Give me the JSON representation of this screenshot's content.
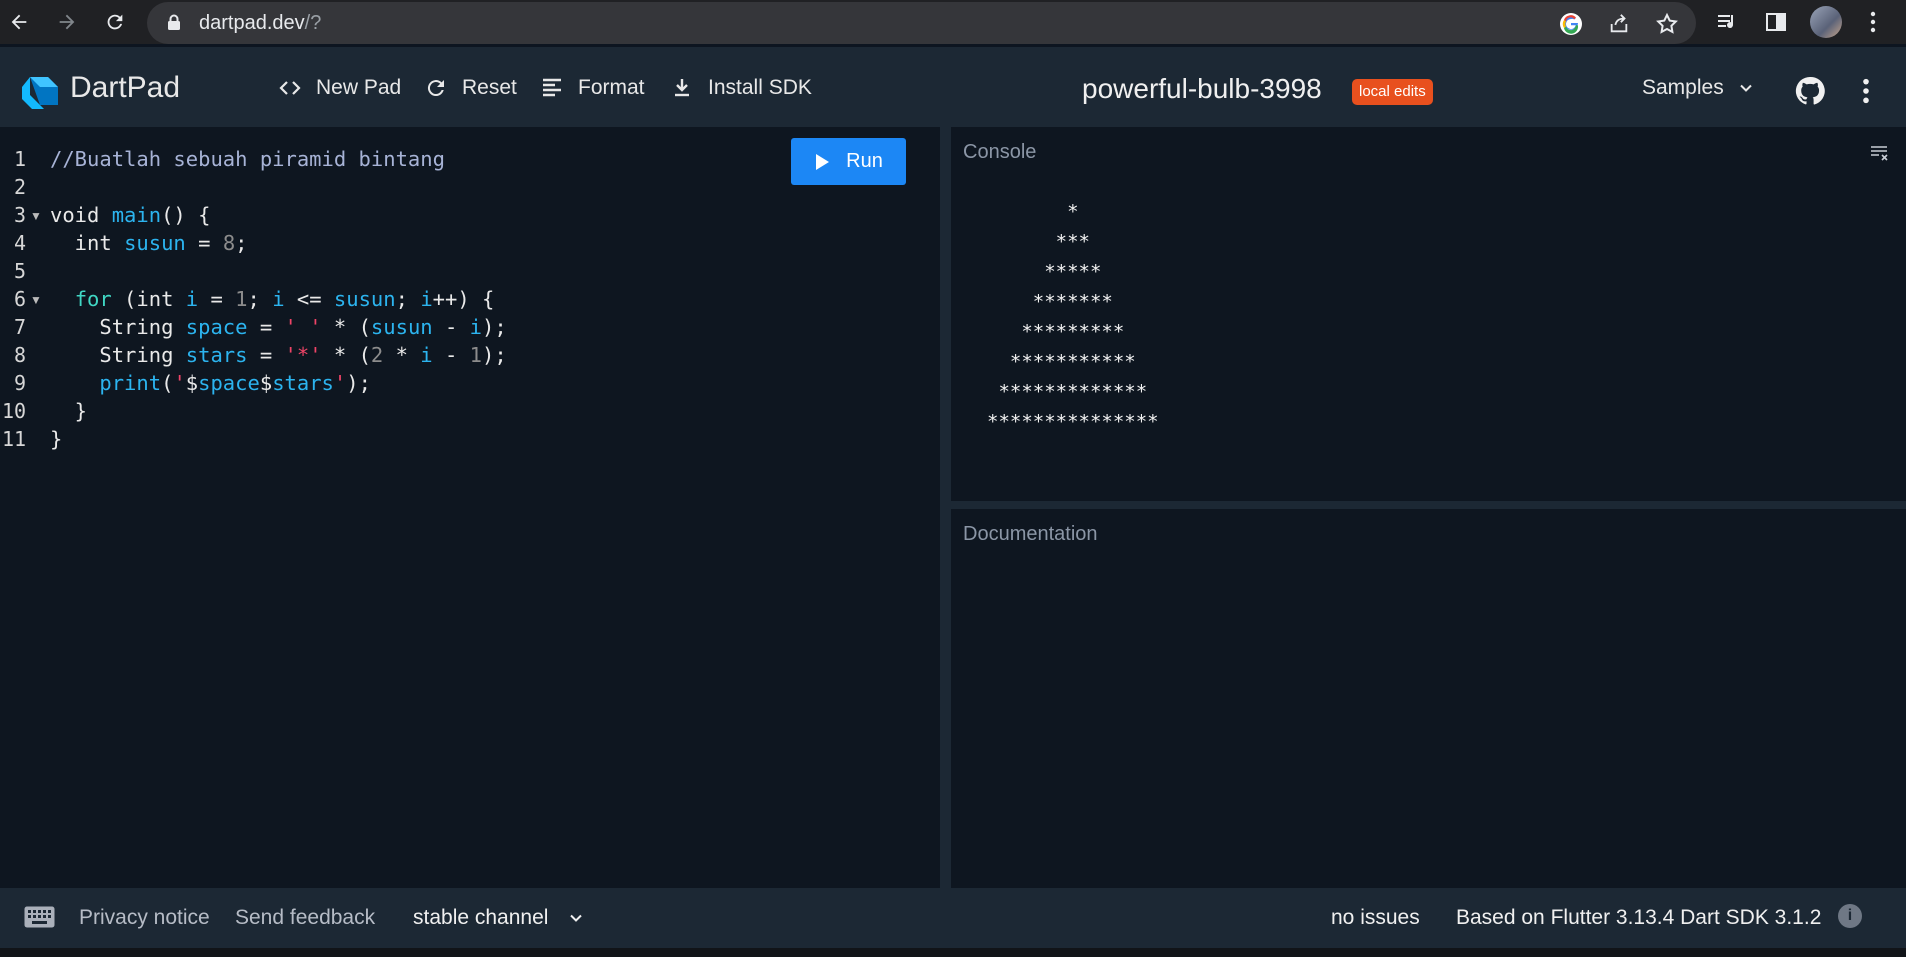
{
  "browser": {
    "url_host": "dartpad.dev",
    "url_path": "/?"
  },
  "header": {
    "brand": "DartPad",
    "buttons": {
      "new_pad": "New Pad",
      "reset": "Reset",
      "format": "Format",
      "install_sdk": "Install SDK"
    },
    "pad_title": "powerful-bulb-3998",
    "badge": "local edits",
    "samples": "Samples"
  },
  "editor": {
    "run_label": "Run",
    "line_numbers": [
      "1",
      "2",
      "3",
      "4",
      "5",
      "6",
      "7",
      "8",
      "9",
      "10",
      "11"
    ],
    "lines": {
      "l1_comment": "//Buatlah sebuah piramid bintang",
      "l3_void": "void ",
      "l3_main": "main",
      "l3_rest": "() {",
      "l4_int": "  int ",
      "l4_var": "susun",
      "l4_eq": " = ",
      "l4_num": "8",
      "l4_semi": ";",
      "l6_indent": "  ",
      "l6_for": "for",
      "l6_a": " (int ",
      "l6_i1": "i",
      "l6_b": " = ",
      "l6_one": "1",
      "l6_c": "; ",
      "l6_i2": "i",
      "l6_d": " <= ",
      "l6_susun": "susun",
      "l6_e": "; ",
      "l6_i3": "i",
      "l6_f": "++) {",
      "l7_a": "    String ",
      "l7_space": "space",
      "l7_b": " = ",
      "l7_str": "' '",
      "l7_c": " * (",
      "l7_susun": "susun",
      "l7_d": " - ",
      "l7_i": "i",
      "l7_e": ");",
      "l8_a": "    String ",
      "l8_stars": "stars",
      "l8_b": " = ",
      "l8_str": "'*'",
      "l8_c": " * (",
      "l8_two": "2",
      "l8_d": " * ",
      "l8_i": "i",
      "l8_e": " - ",
      "l8_one": "1",
      "l8_f": ");",
      "l9_a": "    ",
      "l9_print": "print",
      "l9_b": "(",
      "l9_q1": "'",
      "l9_c": "$",
      "l9_space": "space",
      "l9_d": "$",
      "l9_stars": "stars",
      "l9_q2": "'",
      "l9_e": ");",
      "l10": "  }",
      "l11": "}"
    }
  },
  "console": {
    "label": "Console",
    "output": "       *\n      ***\n     *****\n    *******\n   *********\n  ***********\n *************\n***************"
  },
  "documentation": {
    "label": "Documentation"
  },
  "footer": {
    "privacy": "Privacy notice",
    "feedback": "Send feedback",
    "channel": "stable channel",
    "issues": "no issues",
    "version": "Based on Flutter 3.13.4 Dart SDK 3.1.2",
    "info": "i"
  },
  "colors": {
    "run_button": "#1c87f5",
    "badge": "#e8501e",
    "header_bg": "#1c2834",
    "editor_bg": "#0e1620"
  }
}
